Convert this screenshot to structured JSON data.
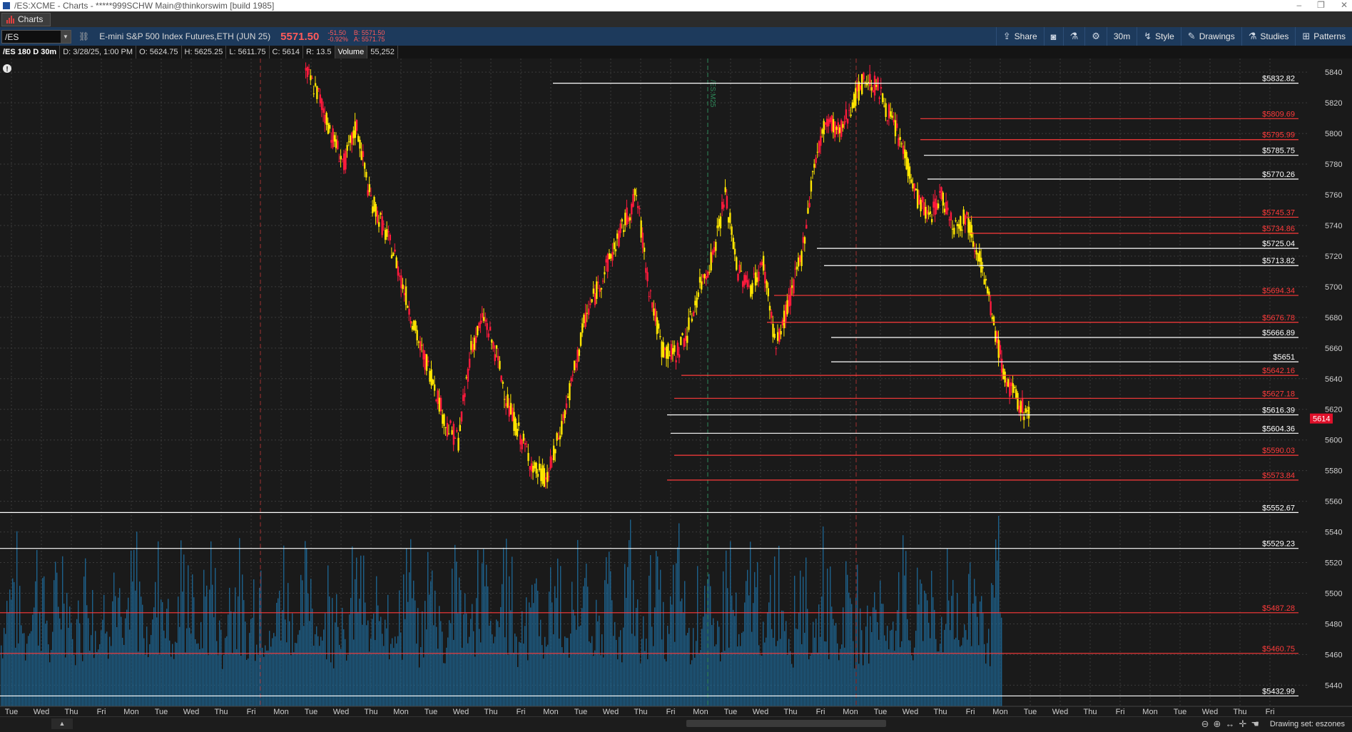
{
  "window": {
    "title": "/ES:XCME - Charts - *****999SCHW Main@thinkorswim [build 1985]",
    "buttons": [
      "–",
      "❐",
      "✕"
    ]
  },
  "tabs": [
    {
      "label": "Charts"
    }
  ],
  "toolbar": {
    "symbol": "/ES",
    "instrument": "E-mini S&P 500 Index Futures,ETH (JUN 25)",
    "last": "5571.50",
    "change": "-51.50",
    "change_pct": "-0.92%",
    "bid": "B: 5571.50",
    "ask": "A: 5571.75",
    "buttons": [
      {
        "name": "share",
        "label": "Share",
        "icon": "share-icon"
      },
      {
        "name": "screenshot",
        "label": "",
        "icon": "camera-icon"
      },
      {
        "name": "flask",
        "label": "",
        "icon": "flask-icon"
      },
      {
        "name": "settings",
        "label": "",
        "icon": "gear-icon"
      },
      {
        "name": "aggregation",
        "label": "30m",
        "icon": ""
      },
      {
        "name": "style",
        "label": "Style",
        "icon": "style-icon"
      },
      {
        "name": "drawings",
        "label": "Drawings",
        "icon": "pencil-icon"
      },
      {
        "name": "studies",
        "label": "Studies",
        "icon": "flask-icon"
      },
      {
        "name": "patterns",
        "label": "Patterns",
        "icon": "pattern-icon"
      }
    ]
  },
  "infobar": {
    "name": "/ES 180 D 30m",
    "date": "D: 3/28/25, 1:00 PM",
    "open": "O: 5624.75",
    "high": "H: 5625.25",
    "low": "L: 5611.75",
    "close": "C: 5614",
    "range": "R: 13.5",
    "volume_label": "Volume",
    "volume": "55,252"
  },
  "chart_data": {
    "type": "candlestick",
    "title": "",
    "ylim": [
      5429,
      5848
    ],
    "y_ticks": [
      5840,
      5820,
      5800,
      5780,
      5760,
      5740,
      5720,
      5700,
      5680,
      5660,
      5640,
      5620,
      5600,
      5580,
      5560,
      5540,
      5520,
      5500,
      5480,
      5460,
      5440
    ],
    "current_price_label": "5614",
    "x_ticks": [
      "Tue",
      "Wed",
      "Thu",
      "Fri",
      "Mon",
      "Tue",
      "Wed",
      "Thu",
      "Fri",
      "Mon",
      "Tue",
      "Wed",
      "Thu",
      "Mon",
      "Tue",
      "Wed",
      "Thu",
      "Fri",
      "Mon",
      "Tue",
      "Wed",
      "Thu",
      "Fri",
      "Mon",
      "Tue",
      "Wed",
      "Thu",
      "Fri",
      "Mon",
      "Tue",
      "Wed",
      "Thu",
      "Fri",
      "Mon",
      "Tue",
      "Wed",
      "Thu",
      "Fri",
      "Mon",
      "Tue",
      "Wed",
      "Thu",
      "Fri"
    ],
    "study_label": "/ES:M25",
    "levels": [
      {
        "price": 5832.82,
        "label": "$5832.82",
        "color": "#ffffff"
      },
      {
        "price": 5809.69,
        "label": "$5809.69",
        "color": "#ff3b3b"
      },
      {
        "price": 5795.99,
        "label": "$5795.99",
        "color": "#ff3b3b"
      },
      {
        "price": 5785.75,
        "label": "$5785.75",
        "color": "#ffffff"
      },
      {
        "price": 5770.26,
        "label": "$5770.26",
        "color": "#ffffff"
      },
      {
        "price": 5745.37,
        "label": "$5745.37",
        "color": "#ff3b3b"
      },
      {
        "price": 5734.86,
        "label": "$5734.86",
        "color": "#ff3b3b"
      },
      {
        "price": 5725.04,
        "label": "$5725.04",
        "color": "#ffffff"
      },
      {
        "price": 5713.82,
        "label": "$5713.82",
        "color": "#ffffff"
      },
      {
        "price": 5694.34,
        "label": "$5694.34",
        "color": "#ff3b3b"
      },
      {
        "price": 5676.78,
        "label": "$5676.78",
        "color": "#ff3b3b"
      },
      {
        "price": 5666.89,
        "label": "$5666.89",
        "color": "#ffffff"
      },
      {
        "price": 5651.0,
        "label": "$5651",
        "color": "#ffffff"
      },
      {
        "price": 5642.16,
        "label": "$5642.16",
        "color": "#ff3b3b"
      },
      {
        "price": 5627.18,
        "label": "$5627.18",
        "color": "#ff3b3b"
      },
      {
        "price": 5616.39,
        "label": "$5616.39",
        "color": "#ffffff"
      },
      {
        "price": 5604.36,
        "label": "$5604.36",
        "color": "#ffffff"
      },
      {
        "price": 5590.03,
        "label": "$5590.03",
        "color": "#ff3b3b"
      },
      {
        "price": 5573.84,
        "label": "$5573.84",
        "color": "#ff3b3b"
      },
      {
        "price": 5552.67,
        "label": "$5552.67",
        "color": "#ffffff"
      },
      {
        "price": 5529.23,
        "label": "$5529.23",
        "color": "#ffffff"
      },
      {
        "price": 5487.28,
        "label": "$5487.28",
        "color": "#ff3b3b"
      },
      {
        "price": 5460.75,
        "label": "$5460.75",
        "color": "#ff3b3b"
      },
      {
        "price": 5432.99,
        "label": "$5432.99",
        "color": "#ffffff"
      }
    ],
    "price_path": [
      [
        24,
        5840
      ],
      [
        25,
        5825
      ],
      [
        26,
        5800
      ],
      [
        27,
        5780
      ],
      [
        28,
        5805
      ],
      [
        29,
        5760
      ],
      [
        30,
        5740
      ],
      [
        31,
        5720
      ],
      [
        32,
        5690
      ],
      [
        33,
        5660
      ],
      [
        34,
        5640
      ],
      [
        35,
        5610
      ],
      [
        36,
        5600
      ],
      [
        37,
        5660
      ],
      [
        38,
        5680
      ],
      [
        39,
        5655
      ],
      [
        40,
        5620
      ],
      [
        41,
        5600
      ],
      [
        42,
        5580
      ],
      [
        43,
        5575
      ],
      [
        44,
        5605
      ],
      [
        45,
        5640
      ],
      [
        46,
        5680
      ],
      [
        47,
        5700
      ],
      [
        48,
        5720
      ],
      [
        49,
        5740
      ],
      [
        50,
        5760
      ],
      [
        51,
        5700
      ],
      [
        52,
        5660
      ],
      [
        53,
        5655
      ],
      [
        54,
        5670
      ],
      [
        55,
        5700
      ],
      [
        56,
        5720
      ],
      [
        57,
        5760
      ],
      [
        58,
        5710
      ],
      [
        59,
        5700
      ],
      [
        60,
        5715
      ],
      [
        61,
        5660
      ],
      [
        62,
        5690
      ],
      [
        63,
        5720
      ],
      [
        64,
        5780
      ],
      [
        65,
        5810
      ],
      [
        66,
        5800
      ],
      [
        67,
        5820
      ],
      [
        68,
        5836
      ],
      [
        69,
        5830
      ],
      [
        70,
        5810
      ],
      [
        71,
        5790
      ],
      [
        72,
        5760
      ],
      [
        73,
        5745
      ],
      [
        74,
        5760
      ],
      [
        75,
        5740
      ],
      [
        76,
        5745
      ],
      [
        77,
        5720
      ],
      [
        78,
        5680
      ],
      [
        79,
        5640
      ],
      [
        80,
        5625
      ],
      [
        81,
        5614
      ]
    ],
    "x_total": 103,
    "colors": {
      "up": "#ffe600",
      "down": "#ff1a3d",
      "volume": "#1f6ea0",
      "grid": "#3a3a3a"
    }
  },
  "bottombar": {
    "drawing_set": "Drawing set: eszones",
    "collapse_label": "▲"
  }
}
